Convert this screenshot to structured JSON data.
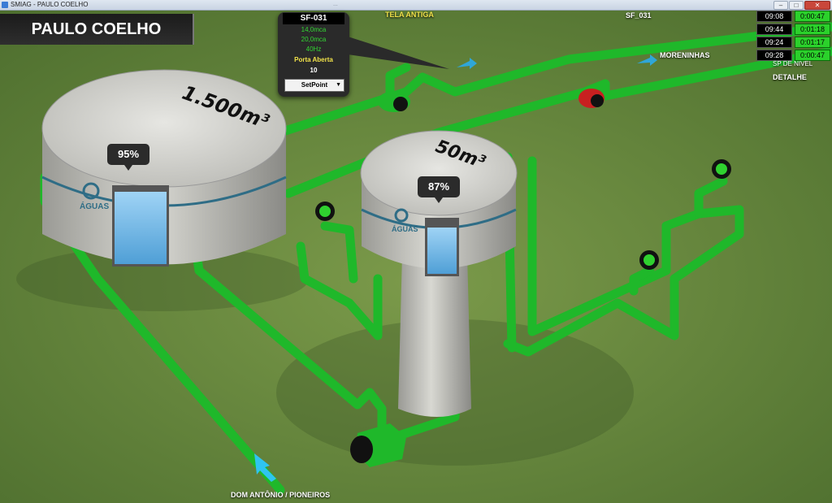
{
  "window": {
    "title": "SMIAG - PAULO COELHO",
    "subtitle": "...",
    "buttons": {
      "minimize": "–",
      "maximize": "□",
      "close": "✕"
    }
  },
  "station": {
    "name": "PAULO COELHO"
  },
  "popup": {
    "id": "SF-031",
    "pressure_1": "14,0mca",
    "pressure_2": "20,0mca",
    "frequency": "40Hz",
    "door_status": "Porta Aberta",
    "value": "10",
    "setpoint_label": "SetPoint",
    "colors": {
      "green": "#33d633",
      "yellow": "#f2e34a",
      "white": "#ffffff"
    }
  },
  "labels": {
    "tela_antiga": "TELA ANTIGA",
    "sf_031": "SF_031",
    "moreninhas": "MORENINHAS",
    "sp_nivel": "SP DE NÍVEL",
    "detalhe": "DETALHE",
    "dom_antonio": "DOM ANTÔNIO / PIONEIROS"
  },
  "timers": [
    {
      "time": "09:08",
      "duration": "0:00:47"
    },
    {
      "time": "09:44",
      "duration": "0:01:18"
    },
    {
      "time": "09:24",
      "duration": "0:01:17"
    },
    {
      "time": "09:28",
      "duration": "0:00:47"
    }
  ],
  "tanks": {
    "large": {
      "capacity": "1.500m³",
      "level": "95%",
      "level_fraction": 0.95,
      "logo": "ÁGUAS"
    },
    "small": {
      "capacity": "50m³",
      "level": "87%",
      "level_fraction": 0.87,
      "logo": "ÁGUAS"
    }
  },
  "colors": {
    "pipe": "#1fb82a",
    "pipe_dark": "#0e7a18",
    "grass": "#5d7d3a",
    "pump_running": "#1fb82a",
    "pump_stopped": "#c82020",
    "water": "#6fb6e6"
  }
}
